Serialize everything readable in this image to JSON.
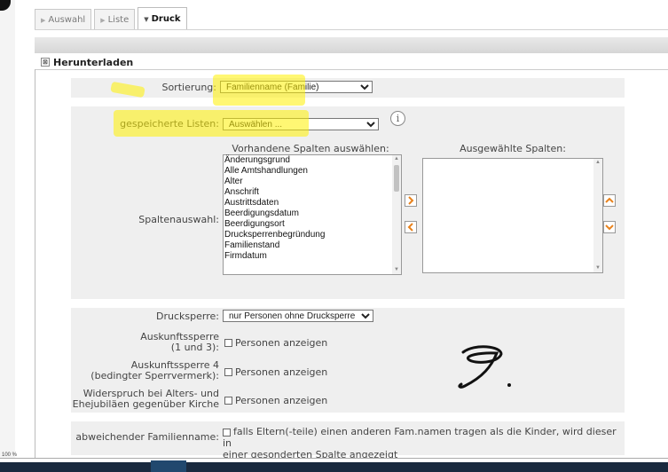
{
  "tabs": [
    {
      "label": "Auswahl",
      "active": false
    },
    {
      "label": "Liste",
      "active": false
    },
    {
      "label": "Druck",
      "active": true
    }
  ],
  "section": {
    "title": "Herunterladen"
  },
  "sorting": {
    "label": "Sortierung:",
    "value": "Familienname (Familie)"
  },
  "saved_lists": {
    "label": "gespeicherte Listen:",
    "value": "Auswählen ..."
  },
  "columns": {
    "label": "Spaltenauswahl:",
    "available_header": "Vorhandene Spalten auswählen:",
    "selected_header": "Ausgewählte Spalten:",
    "available": [
      "Änderungsgrund",
      "Alle Amtshandlungen",
      "Alter",
      "Anschrift",
      "Austrittsdaten",
      "Beerdigungsdatum",
      "Beerdigungsort",
      "Drucksperrenbegründung",
      "Familienstand",
      "Firmdatum"
    ],
    "selected": []
  },
  "print_lock": {
    "label": "Drucksperre:",
    "value": "nur Personen ohne Drucksperre"
  },
  "info_lock_1_3": {
    "label_line1": "Auskunftssperre",
    "label_line2": "(1 und 3):",
    "option": "Personen anzeigen"
  },
  "info_lock_4": {
    "label_line1": "Auskunftssperre 4",
    "label_line2": "(bedingter Sperrvermerk):",
    "option": "Personen anzeigen"
  },
  "objection": {
    "label_line1": "Widerspruch bei Alters- und",
    "label_line2": "Ehejubiläen gegenüber Kirche",
    "option": "Personen anzeigen"
  },
  "other_name": {
    "label": "abweichender Familienname:",
    "option_line1": "falls Eltern(-teile) einen anderen Fam.namen tragen als die Kinder, wird dieser in",
    "option_line2": "einer gesonderten Spalte angezeigt"
  },
  "status": {
    "zoom": "100 %"
  },
  "colors": {
    "highlight": "#fff000",
    "arrow_orange": "#e8821c"
  }
}
